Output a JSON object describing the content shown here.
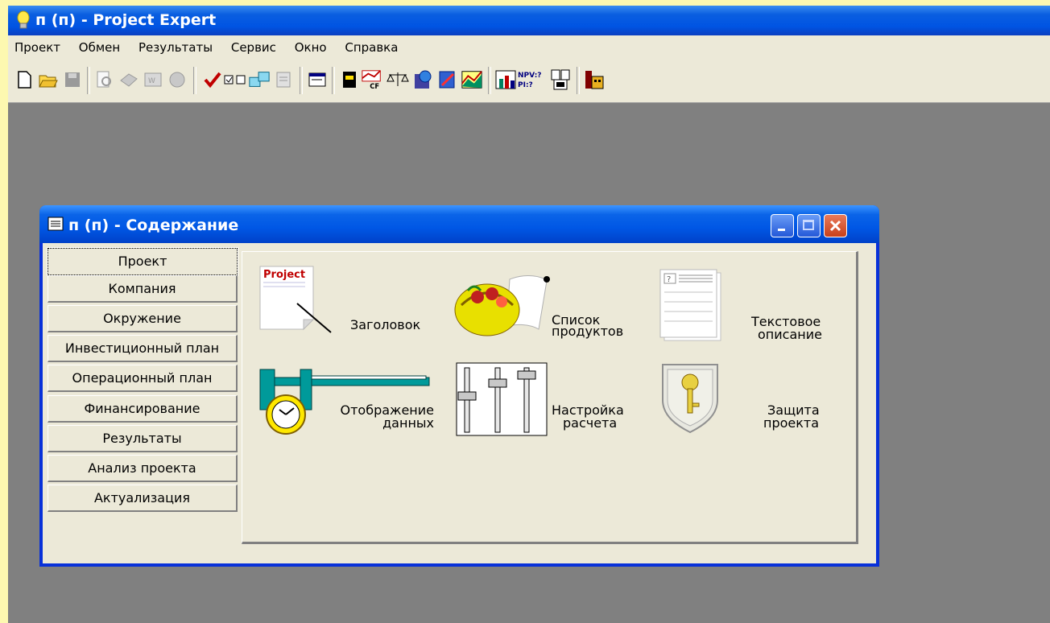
{
  "app": {
    "title": "п (п) - Project Expert",
    "menu": [
      "Проект",
      "Обмен",
      "Результаты",
      "Сервис",
      "Окно",
      "Справка"
    ]
  },
  "window": {
    "title": "п (п) - Содержание",
    "tabs": [
      "Проект",
      "Компания",
      "Окружение",
      "Инвестиционный план",
      "Операционный план",
      "Финансирование",
      "Результаты",
      "Анализ проекта",
      "Актуализация"
    ],
    "active_tab": "Проект",
    "items": {
      "title_icon_text": "Project",
      "title_label": "Заголовок",
      "products_line1": "Список",
      "products_line2": "продуктов",
      "text_line1": "Текстовое",
      "text_line2": "описание",
      "display_line1": "Отображение",
      "display_line2": "данных",
      "calc_line1": "Настройка",
      "calc_line2": "расчета",
      "protect_line1": "Защита",
      "protect_line2": "проекта"
    }
  },
  "toolbar": {
    "icons": [
      "new-icon",
      "open-icon",
      "save-icon",
      "preview-icon",
      "print-icon",
      "report-icon",
      "globe-icon",
      "check-icon",
      "checkbox-icon",
      "exchange-icon",
      "list-icon",
      "window-icon",
      "card-icon",
      "cashflow-chart-icon",
      "balance-icon",
      "calculator-globe-icon",
      "graph-icon",
      "area-chart-icon",
      "bar-chart-icon",
      "npv-icon",
      "table-icon",
      "factory-icon"
    ],
    "npv_text_1": "NPV:?",
    "npv_text_2": "PI:?",
    "cf_text": "CF"
  },
  "colors": {
    "desktop": "#808080",
    "face": "#ece9d8",
    "xp_blue": "#0054e3",
    "background": "#fdf8b0"
  }
}
